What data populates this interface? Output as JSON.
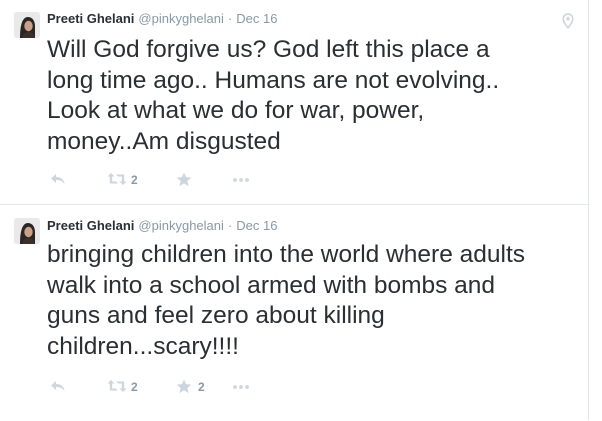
{
  "tweets": [
    {
      "fullname": "Preeti Ghelani",
      "username": "@pinkyghelani",
      "separator": "·",
      "time": "Dec 16",
      "text_lines": [
        "Will God forgive us? God left this place a",
        "long time ago.. Humans are not evolving..",
        "Look at what we do for war, power,",
        "money..Am disgusted"
      ],
      "retweet_count": "2",
      "favorite_count": "",
      "has_location_icon": true
    },
    {
      "fullname": "Preeti Ghelani",
      "username": "@pinkyghelani",
      "separator": "·",
      "time": "Dec 16",
      "text_lines": [
        "bringing children into the world where adults",
        "walk into a school armed with bombs and",
        "guns and feel zero about killing",
        "children...scary!!!!"
      ],
      "retweet_count": "2",
      "favorite_count": "2",
      "has_location_icon": false
    }
  ],
  "icons": {
    "reply": "reply-icon",
    "retweet": "retweet-icon",
    "favorite": "star-icon",
    "more": "more-icon",
    "location": "location-pin-icon"
  },
  "colors": {
    "text": "#292f33",
    "meta": "#8899a6",
    "icon": "#ccd6dd",
    "divider": "#e1e8ed"
  }
}
